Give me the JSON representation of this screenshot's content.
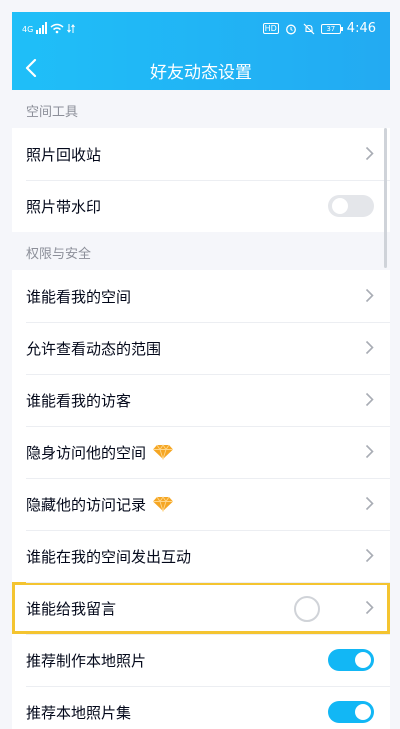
{
  "status_bar": {
    "signal_label": "4G",
    "hd_badge": "HD",
    "battery_level": "37",
    "time": "4:46"
  },
  "header": {
    "title": "好友动态设置",
    "back_icon": "chevron-left-icon"
  },
  "sections": {
    "tools": {
      "heading": "空间工具",
      "items": [
        {
          "label": "照片回收站",
          "control": "chevron"
        },
        {
          "label": "照片带水印",
          "control": "toggle",
          "enabled": false
        }
      ]
    },
    "privacy": {
      "heading": "权限与安全",
      "items": [
        {
          "label": "谁能看我的空间",
          "control": "chevron"
        },
        {
          "label": "允许查看动态的范围",
          "control": "chevron"
        },
        {
          "label": "谁能看我的访客",
          "control": "chevron"
        },
        {
          "label": "隐身访问他的空间",
          "control": "chevron",
          "badge_icon": "diamond-icon"
        },
        {
          "label": "隐藏他的访问记录",
          "control": "chevron",
          "badge_icon": "diamond-icon"
        },
        {
          "label": "谁能在我的空间发出互动",
          "control": "chevron"
        },
        {
          "label": "谁能给我留言",
          "control": "chevron",
          "highlighted": true
        },
        {
          "label": "推荐制作本地照片",
          "control": "toggle",
          "enabled": true
        },
        {
          "label": "推荐本地照片集",
          "control": "toggle",
          "enabled": true
        }
      ]
    }
  },
  "colors": {
    "header_blue": "#1fbff8",
    "toggle_on": "#12b7f5",
    "highlight_outline": "#f4c430",
    "diamond": "#f5a623"
  }
}
